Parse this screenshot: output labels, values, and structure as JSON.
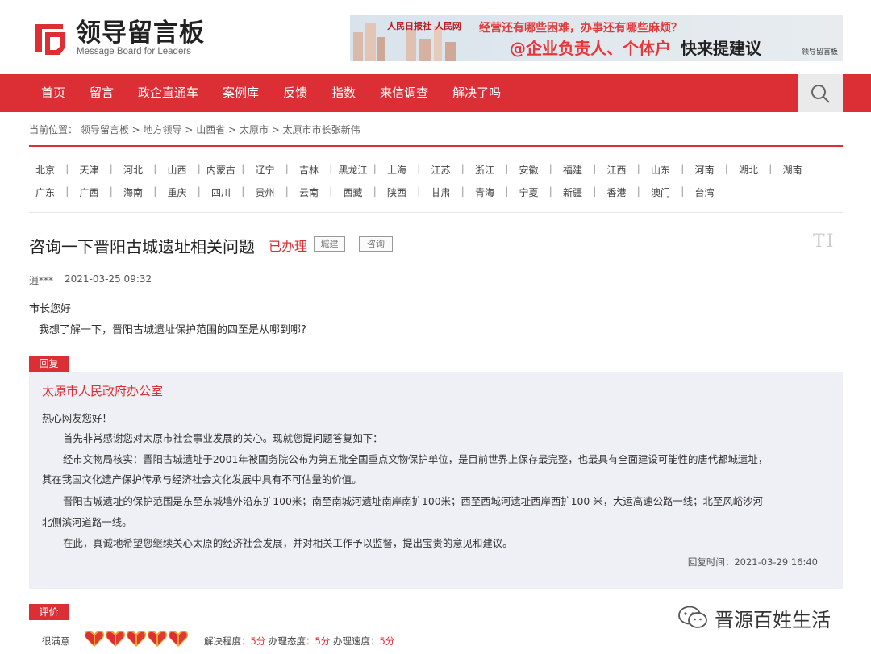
{
  "logo": {
    "cn": "领导留言板",
    "en": "Message Board for Leaders"
  },
  "banner": {
    "outlets": "人民日报社  人民网",
    "question": "经营还有哪些困难，办事还有哪些麻烦？",
    "cta_red": "@企业负责人、个体户",
    "cta_black": "快来提建议",
    "brand": "领导留言板"
  },
  "nav": {
    "items": [
      "首页",
      "留言",
      "政企直通车",
      "案例库",
      "反馈",
      "指数",
      "来信调查",
      "解决了吗"
    ]
  },
  "breadcrumb": {
    "prefix": "当前位置：",
    "path": [
      "领导留言板",
      "地方领导",
      "山西省",
      "太原市",
      "太原市市长张新伟"
    ]
  },
  "provinces": {
    "row1": [
      "北京",
      "天津",
      "河北",
      "山西",
      "内蒙古",
      "辽宁",
      "吉林",
      "黑龙江",
      "上海",
      "江苏",
      "浙江",
      "安徽",
      "福建",
      "江西",
      "山东",
      "河南",
      "湖北",
      "湖南"
    ],
    "row2": [
      "广东",
      "广西",
      "海南",
      "重庆",
      "四川",
      "贵州",
      "云南",
      "西藏",
      "陕西",
      "甘肃",
      "青海",
      "宁夏",
      "新疆",
      "香港",
      "澳门",
      "台湾"
    ]
  },
  "question": {
    "title": "咨询一下晋阳古城遗址相关问题",
    "status": "已办理",
    "tags": [
      "城建",
      "咨询"
    ],
    "author": "逍***",
    "time": "2021-03-25 09:32",
    "greeting": "市长您好",
    "body": "我想了解一下，晋阳古城遗址保护范围的四至是从哪到哪?"
  },
  "reply": {
    "badge": "回复",
    "org": "太原市人民政府办公室",
    "greeting": "热心网友您好！",
    "p1": "首先非常感谢您对太原市社会事业发展的关心。现就您提问题答复如下：",
    "p2a": "经市文物局核实：晋阳古城遗址于2001年被国务院公布为第五批全国重点文物保护单位，是目前世界上保存最完整，也最具有全面建设可能性的唐代都城遗址，",
    "p2b": "其在我国文化遗产保护传承与经济社会文化发展中具有不可估量的价值。",
    "p3a": "晋阳古城遗址的保护范围是东至东城墙外沿东扩100米；南至南城河遗址南岸南扩100米；西至西城河遗址西岸西扩100 米，大运高速公路一线；北至风峪沙河",
    "p3b": "北侧滨河道路一线。",
    "p4": "在此，真诚地希望您继续关心太原的经济社会发展，并对相关工作予以监督，提出宝贵的意见和建议。",
    "time_label": "回复时间：",
    "time": "2021-03-29 16:40"
  },
  "rating": {
    "badge": "评价",
    "label": "很满意",
    "hearts": 5,
    "d1_label": "解决程度：",
    "d1_value": "5分",
    "d2_label": "办理态度：",
    "d2_value": "5分",
    "d3_label": "办理速度：",
    "d3_value": "5分"
  },
  "watermark": {
    "text": "晋源百姓生活"
  },
  "colors": {
    "brand_red": "#dc2f35",
    "reply_bg": "#eef0f5"
  }
}
